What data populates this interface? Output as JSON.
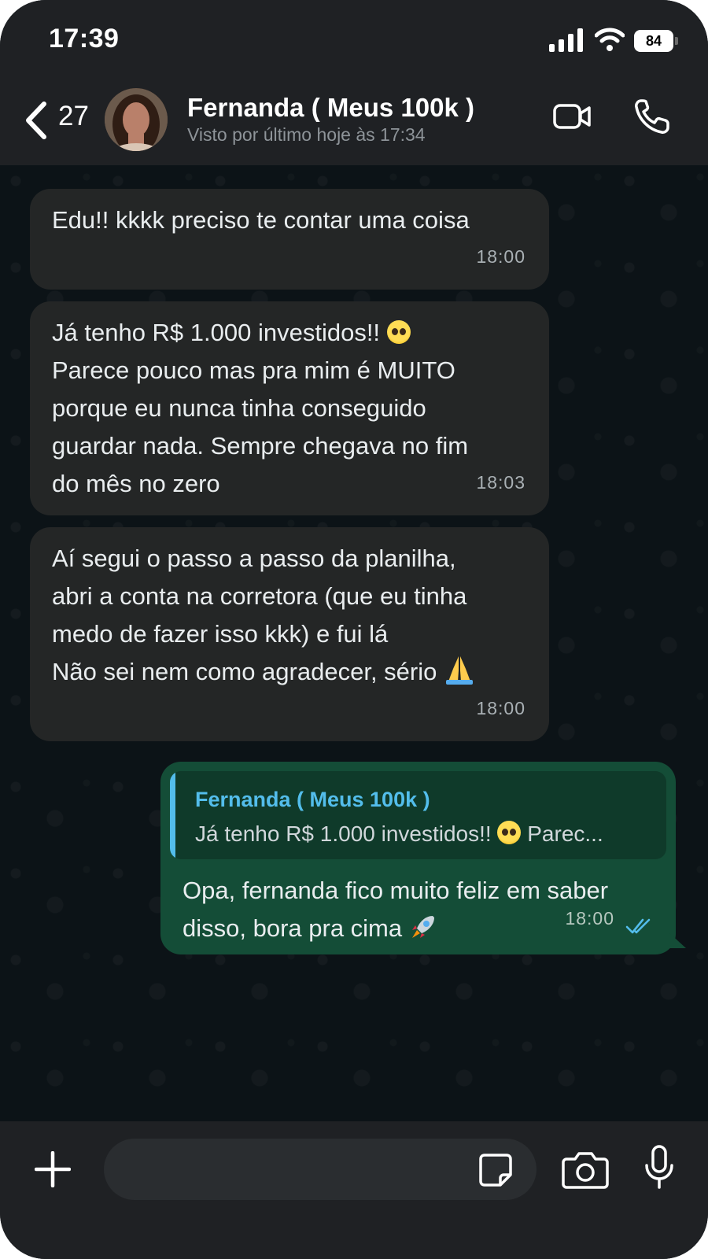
{
  "status_bar": {
    "time": "17:39",
    "battery": "84"
  },
  "header": {
    "back_count": "27",
    "contact_name": "Fernanda ( Meus 100k )",
    "last_seen": "Visto por último hoje às 17:34"
  },
  "messages": [
    {
      "direction": "in",
      "text": "Edu!! kkkk preciso te contar uma coisa",
      "time": "18:00"
    },
    {
      "direction": "in",
      "text_line1": "Já tenho R$ 1.000 investidos!! ",
      "emoji": "🥺",
      "text_rest": "Parece pouco mas pra mim é MUITO\nporque eu nunca tinha conseguido\nguardar nada. Sempre chegava no fim\ndo mês no zero",
      "time": "18:03"
    },
    {
      "direction": "in",
      "text": "Aí segui o passo a passo da planilha,\nabri a conta na corretora (que eu tinha\nmedo de fazer isso kkk) e fui lá\nNão sei nem como agradecer, sério ",
      "emoji": "🙏",
      "time": "18:00"
    },
    {
      "direction": "out",
      "quote_name": "Fernanda ( Meus 100k )",
      "quote_text_a": "Já tenho R$ 1.000 investidos!! ",
      "quote_text_b": " Parec...",
      "text": "Opa, fernanda fico muito feliz em saber\ndisso, bora pra cima ",
      "emoji": "🚀",
      "time": "18:00",
      "status": "read"
    }
  ],
  "composer": {
    "placeholder": ""
  },
  "colors": {
    "incoming_bubble": "#242626",
    "outgoing_bubble": "#144d37",
    "quote_accent": "#53bdeb",
    "read_ticks": "#53bdeb",
    "bar_background": "#1f2124"
  },
  "icons": [
    "back-chevron-icon",
    "video-call-icon",
    "voice-call-icon",
    "plus-icon",
    "sticker-icon",
    "camera-icon",
    "microphone-icon",
    "double-check-icon",
    "signal-icon",
    "wifi-icon",
    "battery-icon"
  ]
}
